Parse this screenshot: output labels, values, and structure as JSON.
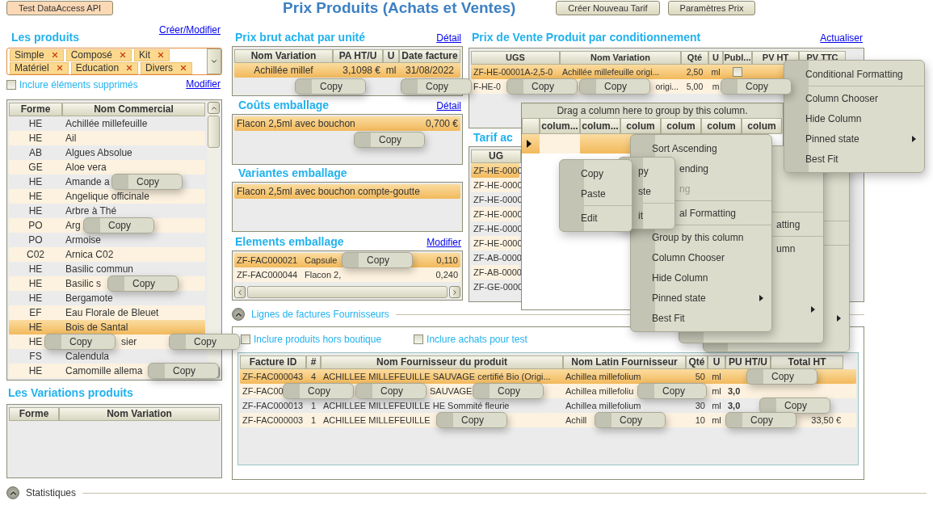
{
  "header": {
    "buttons": [
      {
        "label": "Test DataAccess API",
        "kind": "accent"
      },
      {
        "label": "Créer Nouveau Tarif",
        "kind": "plain"
      },
      {
        "label": "Paramètres Prix",
        "kind": "plain"
      }
    ],
    "title": "Prix Produits (Achats et Ventes)"
  },
  "products": {
    "title": "Les produits",
    "link": "Créer/Modifier",
    "tags": [
      "Simple",
      "Composé",
      "Kit",
      "Matériel",
      "Education",
      "Divers"
    ],
    "include_deleted": {
      "label": "Inclure éléments supprimés",
      "checked": false
    },
    "modify_link": "Modifier",
    "table": {
      "columns": [
        "Forme",
        "Nom Commercial"
      ],
      "rows": [
        {
          "forme": "HE",
          "name": "Achillée millefeuille",
          "selected": false,
          "kind": "plain"
        },
        {
          "forme": "HE",
          "name": "Ail",
          "selected": false,
          "kind": "plain"
        },
        {
          "forme": "AB",
          "name": "Algues Absolue",
          "selected": false,
          "kind": "plain"
        },
        {
          "forme": "GE",
          "name": "Aloe vera",
          "selected": false,
          "kind": "plain"
        },
        {
          "forme": "HE",
          "name": "Amande a",
          "selected": false,
          "kind": "plain"
        },
        {
          "forme": "HE",
          "name": "Angelique officinale",
          "selected": false,
          "kind": "plain"
        },
        {
          "forme": "HE",
          "name": "Arbre à Thé",
          "selected": false,
          "kind": "plain"
        },
        {
          "forme": "PO",
          "name": "Arg",
          "selected": false,
          "kind": "plain"
        },
        {
          "forme": "PO",
          "name": "Armoise",
          "selected": false,
          "kind": "plain"
        },
        {
          "forme": "C02",
          "name": "Arnica C02",
          "selected": false,
          "kind": "plain"
        },
        {
          "forme": "HE",
          "name": "Basilic commun",
          "selected": false,
          "kind": "plain"
        },
        {
          "forme": "HE",
          "name": "Basilic s",
          "selected": false,
          "kind": "plain"
        },
        {
          "forme": "HE",
          "name": "Bergamote",
          "selected": false,
          "kind": "plain"
        },
        {
          "forme": "EF",
          "name": "Eau Florale de Bleuet",
          "selected": false,
          "kind": "plain"
        },
        {
          "forme": "HE",
          "name": "Bois de Santal",
          "selected": true,
          "kind": "plain"
        },
        {
          "forme": "HE",
          "name": "sier",
          "selected": false,
          "kind": "tail"
        },
        {
          "forme": "FS",
          "name": "Calendula",
          "selected": false,
          "kind": "plain"
        },
        {
          "forme": "HE",
          "name": "Camomille allema",
          "selected": false,
          "kind": "plain"
        }
      ]
    }
  },
  "variations": {
    "title": "Les Variations produits",
    "columns": [
      "Forme",
      "Nom Variation"
    ]
  },
  "statistics": {
    "label": "Statistiques",
    "expanded": true
  },
  "purchase_price": {
    "title": "Prix brut achat par unité",
    "link": "Détail",
    "columns": [
      "Nom Variation",
      "PA HT/U",
      "U",
      "Date facture"
    ],
    "rows": [
      {
        "cells": [
          "Achillée millef",
          "3,1098 €",
          "ml",
          "31/08/2022"
        ],
        "selected": true
      }
    ]
  },
  "packaging_costs": {
    "title": "Coûts emballage",
    "link": "Détail",
    "rows": [
      {
        "cells": [
          "Flacon 2,5ml avec bouchon",
          "0,700 €"
        ],
        "selected": true
      }
    ]
  },
  "packaging_variants": {
    "title": "Variantes emballage",
    "rows": [
      {
        "cells": [
          "Flacon 2,5ml avec bouchon compte-goutte"
        ],
        "selected": true
      }
    ]
  },
  "packaging_elements": {
    "title": "Elements emballage",
    "link": "Modifier",
    "rows": [
      {
        "cells": [
          "ZF-FAC000021",
          "Capsule",
          "0,110"
        ],
        "selected": true
      },
      {
        "cells": [
          "ZF-FAC000044",
          "Flacon 2,",
          "0,240"
        ],
        "selected": false
      }
    ]
  },
  "sale_price": {
    "title": "Prix de Vente Produit par conditionnement",
    "link": "Actualiser",
    "columns": [
      "UGS",
      "Nom Variation",
      "Qté",
      "U",
      "Publ...",
      "PV HT",
      "PV TTC"
    ],
    "rows": [
      {
        "cells": [
          "ZF-HE-00001A-2,5-0",
          "Achillée millefeuille origi...",
          "2,50",
          "ml"
        ],
        "published": false,
        "selected": true,
        "kind": "plain"
      },
      {
        "cells": [
          "F-HE-0",
          "origi...",
          "5,00",
          "m"
        ],
        "selected": false,
        "kind": "tail"
      }
    ]
  },
  "tariff": {
    "title": "Tarif ac",
    "columns": [
      "UG"
    ],
    "rows": [
      {
        "ugs": "ZF-HE-0000",
        "selected": true
      },
      {
        "ugs": "ZF-HE-0000",
        "selected": false
      },
      {
        "ugs": "ZF-HE-0000",
        "selected": false
      },
      {
        "ugs": "ZF-HE-0000",
        "selected": false
      },
      {
        "ugs": "ZF-HE-0000",
        "selected": false
      },
      {
        "ugs": "ZF-HE-0000",
        "selected": false
      },
      {
        "ugs": "ZF-AB-0000",
        "selected": false
      },
      {
        "ugs": "ZF-AB-0000",
        "selected": false
      },
      {
        "ugs": "ZF-GE-0000",
        "selected": false
      }
    ]
  },
  "floating_grid": {
    "caption": "Drag a column here to group by this column.",
    "columns": [
      "colum...",
      "colum...",
      "colum",
      "colum",
      "colum",
      "colum"
    ]
  },
  "menus": [
    {
      "items": [
        {
          "kind": "item",
          "label": "Copy"
        },
        {
          "kind": "item",
          "label": "Paste"
        },
        {
          "kind": "separator"
        },
        {
          "kind": "item",
          "label": "Edit"
        }
      ]
    },
    {
      "items": [
        {
          "kind": "clipped",
          "label": "py"
        },
        {
          "kind": "clipped",
          "label": "ste"
        },
        {
          "kind": "separator"
        },
        {
          "kind": "clipped",
          "label": "it"
        }
      ]
    },
    {
      "items": [
        {
          "kind": "item",
          "label": "Sort Ascending"
        },
        {
          "kind": "clipped",
          "label": "ending"
        },
        {
          "kind": "clipped",
          "label": "ng",
          "disabled": true
        },
        {
          "kind": "separator"
        },
        {
          "kind": "clipped",
          "label": "al Formatting"
        },
        {
          "kind": "separator"
        },
        {
          "kind": "item",
          "label": "Group by this column"
        },
        {
          "kind": "item",
          "label": "Column Chooser"
        },
        {
          "kind": "item",
          "label": "Hide Column"
        },
        {
          "kind": "item",
          "label": "Pinned state",
          "submenu": true
        },
        {
          "kind": "item",
          "label": "Best Fit"
        }
      ]
    },
    {
      "items": [
        {
          "kind": "blank"
        },
        {
          "kind": "blank"
        },
        {
          "kind": "blank"
        },
        {
          "kind": "separator"
        },
        {
          "kind": "clipped",
          "label": "atting"
        },
        {
          "kind": "separator"
        },
        {
          "kind": "clipped",
          "label": "umn"
        },
        {
          "kind": "blank"
        },
        {
          "kind": "blank"
        },
        {
          "kind": "blank",
          "submenu": true
        },
        {
          "kind": "blank"
        }
      ]
    },
    {
      "items": [
        {
          "kind": "blank"
        },
        {
          "kind": "blank"
        },
        {
          "kind": "blank"
        },
        {
          "kind": "separator"
        },
        {
          "kind": "blank"
        },
        {
          "kind": "separator"
        },
        {
          "kind": "blank"
        },
        {
          "kind": "blank"
        },
        {
          "kind": "blank"
        },
        {
          "kind": "blank",
          "submenu": true
        },
        {
          "kind": "blank"
        }
      ]
    },
    {
      "items": [
        {
          "kind": "item",
          "label": "Conditional Formatting"
        },
        {
          "kind": "separator"
        },
        {
          "kind": "item",
          "label": "Column Chooser"
        },
        {
          "kind": "item",
          "label": "Hide Column"
        },
        {
          "kind": "item",
          "label": "Pinned state",
          "submenu": true
        },
        {
          "kind": "item",
          "label": "Best Fit"
        }
      ]
    }
  ],
  "invoice_lines": {
    "label": "Lignes de factures Fournisseurs",
    "expanded": true,
    "options": [
      {
        "label": "Inclure produits hors boutique",
        "checked": false
      },
      {
        "label": "Inclure achats pour test",
        "checked": false
      }
    ],
    "columns": [
      "Facture ID",
      "#",
      "Nom Fournisseur du produit",
      "Nom Latin Fournisseur",
      "Qté",
      "U",
      "PU HT/U",
      "Total HT"
    ],
    "rows": [
      {
        "cells": [
          "ZF-FAC000043",
          "4",
          "ACHILLEE MILLEFEUILLE SAUVAGE certifié Bio (Origi...",
          "Achillea millefolium",
          "50",
          "ml"
        ],
        "selected": true,
        "kind": "plain"
      },
      {
        "cells": [
          "ZF-FAC00",
          "",
          "SAUVAGE",
          "Achillea millefoliu",
          "",
          "ml",
          "3,0"
        ],
        "selected": false,
        "kind": "gapped"
      },
      {
        "cells": [
          "ZF-FAC000013",
          "1",
          "ACHILLEE MILLEFEUILLE HE Sommité fleurie",
          "Achillea millefolium",
          "30",
          "ml",
          "3,0"
        ],
        "selected": false,
        "kind": "plain"
      },
      {
        "cells": [
          "ZF-FAC000003",
          "1",
          "ACHILLEE MILLEFEUILLE",
          "Achill",
          "10",
          "ml",
          "",
          "33,50 €"
        ],
        "selected": false,
        "kind": "plain"
      }
    ]
  },
  "popups": [
    {
      "label": "Copy"
    },
    {
      "label": "Copy"
    },
    {
      "label": "Copy"
    },
    {
      "label": "Copy"
    },
    {
      "label": "Copy"
    },
    {
      "label": "Copy"
    },
    {
      "label": "Copy"
    },
    {
      "label": "Copy"
    },
    {
      "label": "Copy"
    },
    {
      "label": "Copy"
    },
    {
      "label": "Copy"
    },
    {
      "label": "Copy"
    },
    {
      "label": "Copy"
    },
    {
      "label": "Copy"
    },
    {
      "label": "Copy"
    },
    {
      "label": "Copy"
    },
    {
      "label": "Copy"
    },
    {
      "label": "Copy"
    },
    {
      "label": "Copy"
    },
    {
      "label": "Copy"
    },
    {
      "label": "Copy"
    },
    {
      "label": "Copy"
    }
  ]
}
